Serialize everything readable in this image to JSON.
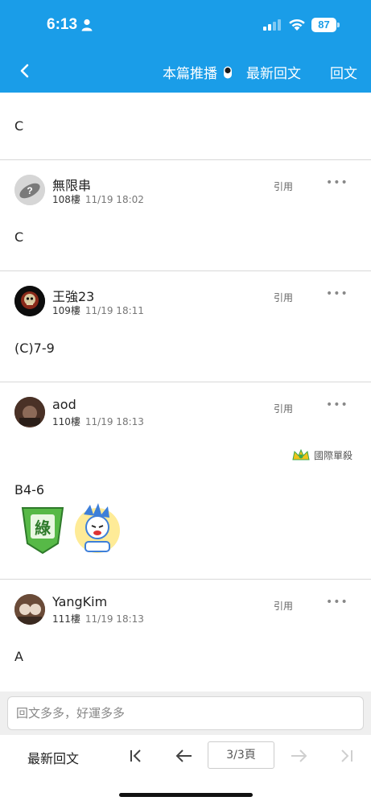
{
  "status": {
    "time": "6:13",
    "battery": "87"
  },
  "nav": {
    "recommend": "本篇推播",
    "latest": "最新回文",
    "reply": "回文"
  },
  "posts": [
    {
      "content": "C"
    },
    {
      "author": "無限串",
      "floor": "108樓",
      "time": "11/19 18:02",
      "quote": "引用",
      "more": "•••",
      "content": "C"
    },
    {
      "author": "王強23",
      "floor": "109樓",
      "time": "11/19 18:11",
      "quote": "引用",
      "more": "•••",
      "content": "(C)7-9"
    },
    {
      "author": "aod",
      "floor": "110樓",
      "time": "11/19 18:13",
      "quote": "引用",
      "more": "•••",
      "tag": "國際單殺",
      "content": "B4-6",
      "sticker_text": "綠"
    },
    {
      "author": "YangKim",
      "floor": "111樓",
      "time": "11/19 18:13",
      "quote": "引用",
      "more": "•••",
      "content": "A"
    }
  ],
  "reply_input": {
    "placeholder": "回文多多，好運多多"
  },
  "pager": {
    "latest": "最新回文",
    "page": "3/3頁"
  },
  "colors": {
    "header": "#1a9de8",
    "tag_green": "#3aa84f"
  }
}
